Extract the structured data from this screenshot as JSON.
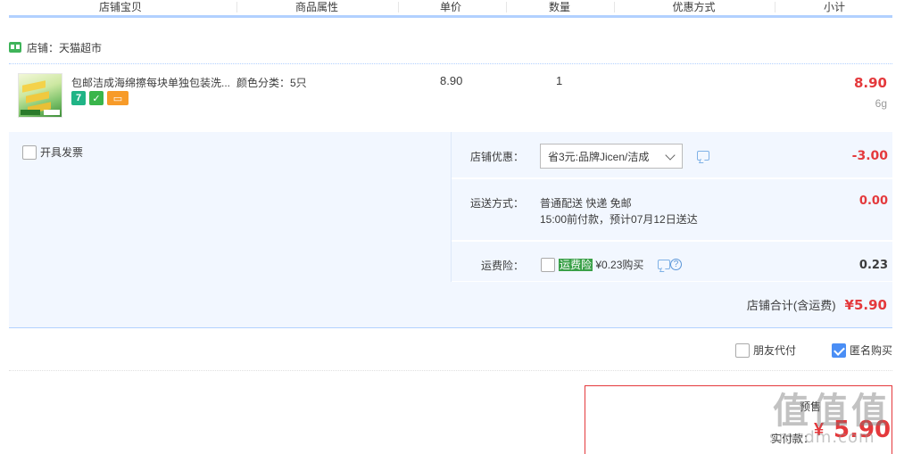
{
  "columns": [
    "店铺宝贝",
    "商品属性",
    "单价",
    "数量",
    "优惠方式",
    "小计"
  ],
  "shop": {
    "label": "店铺：天猫超市",
    "icon": "tmall-shop-icon"
  },
  "item": {
    "title": "包邮洁成海绵擦每块单独包装洗...",
    "badges": [
      "7",
      "✓",
      "▭"
    ],
    "attribute": "颜色分类：5只",
    "unit_price": "8.90",
    "quantity": "1",
    "subtotal": "8.90",
    "weight": "6g"
  },
  "invoice": {
    "label": "开具发票",
    "checked": false
  },
  "shop_discount": {
    "name": "店铺优惠：",
    "selected": "省3元:品牌Jicen/洁成",
    "value": "-3.00"
  },
  "shipping": {
    "name": "运送方式：",
    "line1": "普通配送 快递 免邮",
    "line2": "15:00前付款，预计07月12日送达",
    "value": "0.00"
  },
  "insurance": {
    "name": "运费险：",
    "tag": "运费险",
    "price": "¥0.23购买",
    "value": "0.23",
    "help": "?"
  },
  "shop_total": {
    "label": "店铺合计(含运费)",
    "amount": "¥5.90"
  },
  "options": {
    "friend_pay": "朋友代付",
    "anonymous": "匿名购买",
    "anonymous_checked": true
  },
  "payment": {
    "top_text": "预售",
    "label": "实付款：",
    "currency": "¥",
    "amount": "5.90"
  },
  "watermark": {
    "chars": [
      "值",
      "值",
      "值"
    ],
    "url": "smzdm.com"
  }
}
